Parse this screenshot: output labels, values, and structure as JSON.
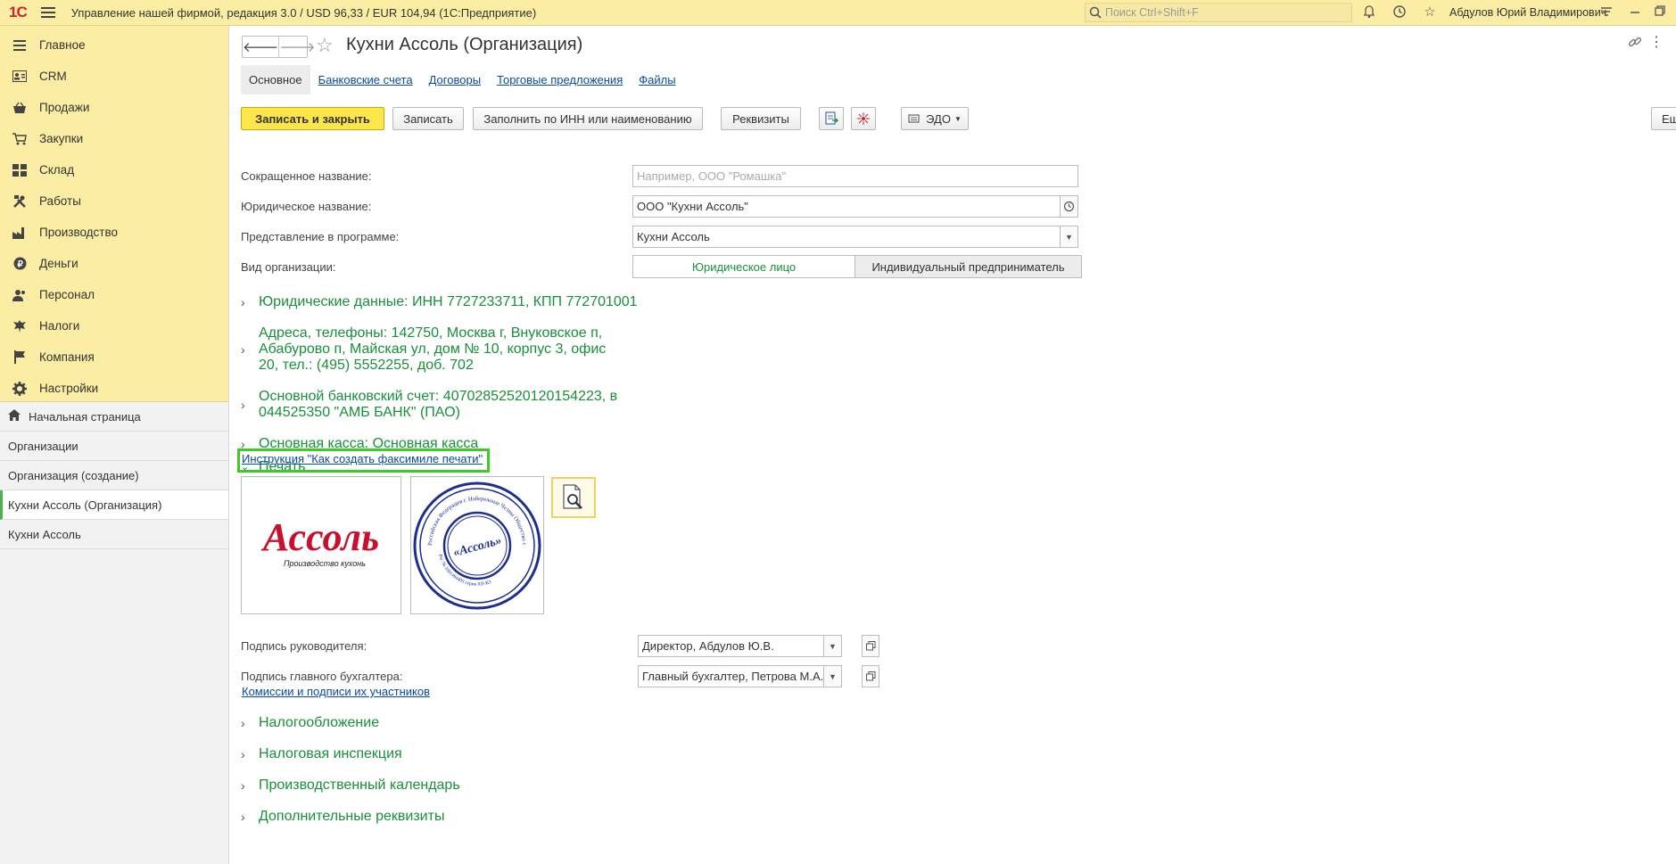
{
  "topbar": {
    "logo": "1С",
    "title": "Управление нашей фирмой, редакция 3.0 / USD 96,33 / EUR 104,94  (1С:Предприятие)",
    "search_placeholder": "Поиск Ctrl+Shift+F",
    "user": "Абдулов Юрий Владимирович"
  },
  "sidebar": {
    "sections": [
      {
        "label": "Главное",
        "icon": "menu-lines-icon"
      },
      {
        "label": "CRM",
        "icon": "contact-card-icon"
      },
      {
        "label": "Продажи",
        "icon": "basket-icon"
      },
      {
        "label": "Закупки",
        "icon": "cart-icon"
      },
      {
        "label": "Склад",
        "icon": "warehouse-icon"
      },
      {
        "label": "Работы",
        "icon": "tools-icon"
      },
      {
        "label": "Производство",
        "icon": "factory-icon"
      },
      {
        "label": "Деньги",
        "icon": "ruble-icon"
      },
      {
        "label": "Персонал",
        "icon": "people-icon"
      },
      {
        "label": "Налоги",
        "icon": "eagle-icon"
      },
      {
        "label": "Компания",
        "icon": "flag-icon"
      },
      {
        "label": "Настройки",
        "icon": "gear-icon"
      }
    ],
    "open_windows": [
      {
        "label": "Начальная страница"
      },
      {
        "label": "Организации"
      },
      {
        "label": "Организация (создание)"
      },
      {
        "label": "Кухни Ассоль (Организация)"
      },
      {
        "label": "Кухни Ассоль"
      }
    ]
  },
  "form": {
    "title": "Кухни Ассоль (Организация)",
    "tabs": [
      "Основное",
      "Банковские счета",
      "Договоры",
      "Торговые предложения",
      "Файлы"
    ],
    "buttons": {
      "save_close": "Записать и закрыть",
      "save": "Записать",
      "fill_inn": "Заполнить по ИНН или наименованию",
      "requisites": "Реквизиты",
      "edo": "ЭДО",
      "more": "Еще"
    },
    "fields": {
      "short_name_label": "Сокращенное название:",
      "short_name_placeholder": "Например, ООО \"Ромашка\"",
      "legal_name_label": "Юридическое название:",
      "legal_name_value": "ООО \"Кухни Ассоль\"",
      "display_label": "Представление в программе:",
      "display_value": "Кухни Ассоль",
      "org_type_label": "Вид организации:",
      "org_type_options": [
        "Юридическое лицо",
        "Индивидуальный предприниматель"
      ],
      "org_type_selected": "Юридическое лицо"
    },
    "groups": {
      "legal": "Юридические данные: ИНН 7727233711, КПП 772701001",
      "address_lines": [
        "Адреса, телефоны: 142750, Москва г, Внуковское п,",
        "Абабурово п, Майская ул, дом № 10, корпус 3, офис",
        "20, тел.: (495) 5552255, доб. 702"
      ],
      "bank_lines": [
        "Основной банковский счет: 40702852520120154223, в",
        "044525350 \"АМБ БАНК\" (ПАО)"
      ],
      "cash": "Основная касса: Основная касса",
      "print": "Печать",
      "taxation": "Налогообложение",
      "tax_office": "Налоговая инспекция",
      "calendar": "Производственный календарь",
      "extra": "Дополнительные реквизиты"
    },
    "print": {
      "instruction_link": "Инструкция \"Как создать факсимиле печати\"",
      "logo_text": "Ассоль",
      "logo_caption": "Производство кухонь",
      "stamp_center": "«Ассоль»",
      "stamp_ring_text": "Российская Федерация  г. Набережные Челны  Общество с ограниченной ответственностью",
      "stamp_bottom_text": "Рег. № 1001494405 серия XII-КЗ",
      "director_label": "Подпись руководителя:",
      "director_value": "Директор, Абдулов Ю.В.",
      "accountant_label": "Подпись главного бухгалтера:",
      "accountant_value": "Главный бухгалтер, Петрова М.А.",
      "commissions_link": "Комиссии и подписи их участников"
    }
  }
}
